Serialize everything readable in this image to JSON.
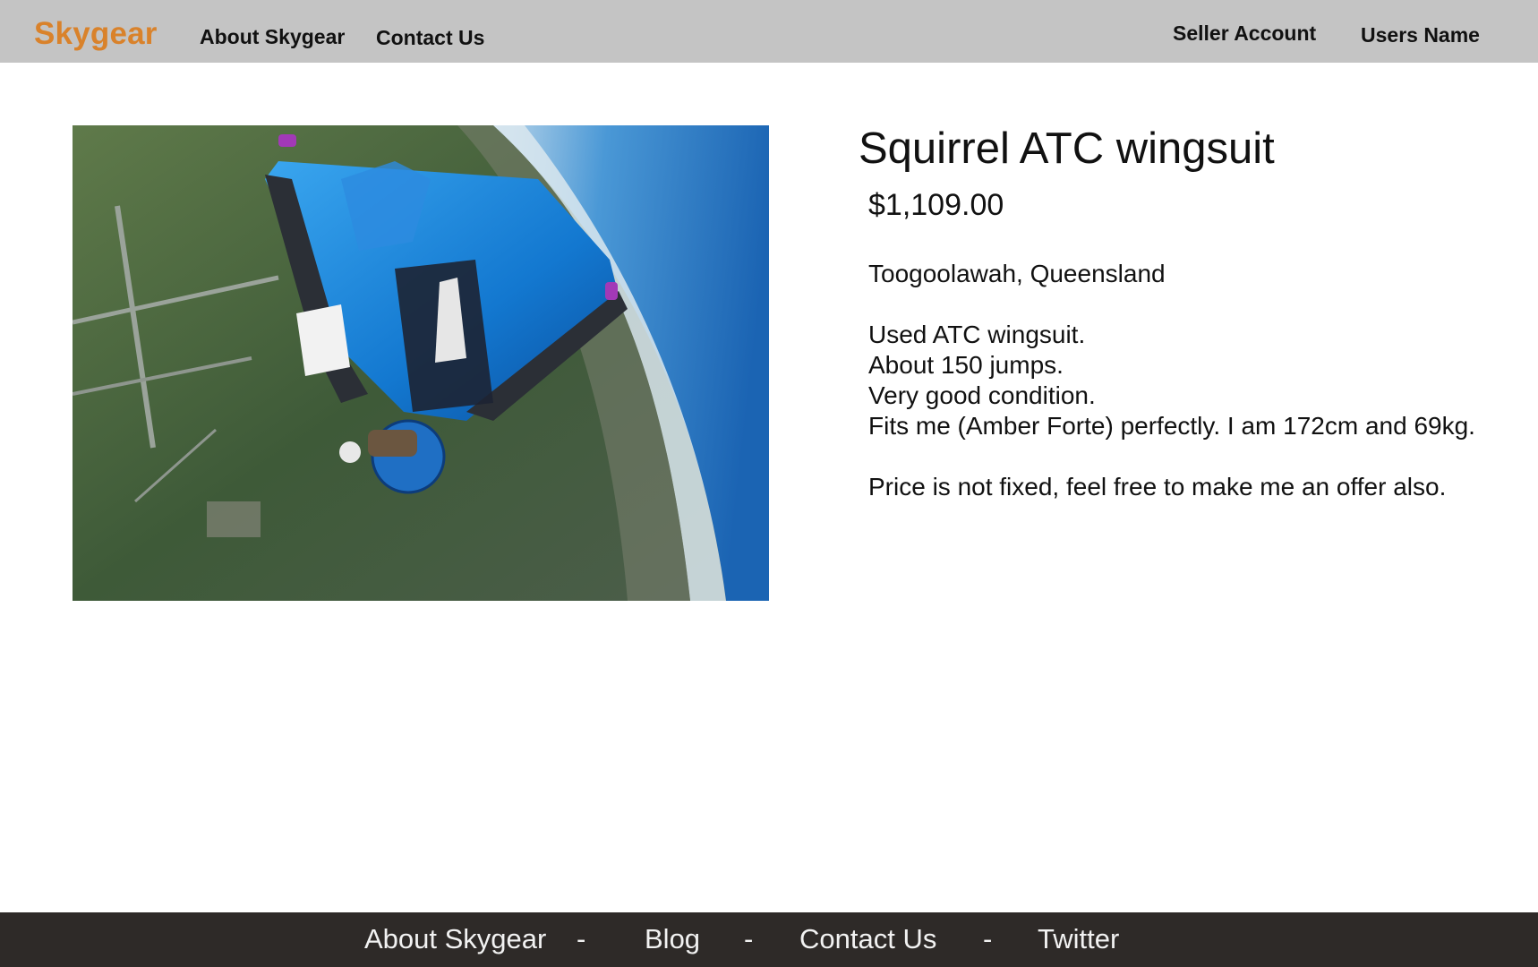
{
  "header": {
    "logo": "Skygear",
    "nav": {
      "about": "About Skygear",
      "contact": "Contact Us"
    },
    "account": {
      "seller": "Seller Account",
      "user": "Users Name"
    }
  },
  "product": {
    "image_icon": "wingsuit-skydiver-photo",
    "title": "Squirrel ATC wingsuit",
    "price": "$1,109.00",
    "location": "Toogoolawah, Queensland",
    "description": {
      "line1": "Used ATC wingsuit.",
      "line2": "About 150 jumps.",
      "line3": "Very good condition.",
      "line4": "Fits me (Amber Forte) perfectly. I am 172cm and 69kg.",
      "line5": "Price is not fixed, feel free to make me an offer also."
    }
  },
  "footer": {
    "about": "About Skygear",
    "sep": "-",
    "blog": "Blog",
    "contact": "Contact Us",
    "twitter": "Twitter"
  },
  "colors": {
    "header_bg": "#c4c4c4",
    "logo": "#d9822b",
    "footer_bg": "#2e2a28",
    "footer_text": "#f2f2f2"
  }
}
